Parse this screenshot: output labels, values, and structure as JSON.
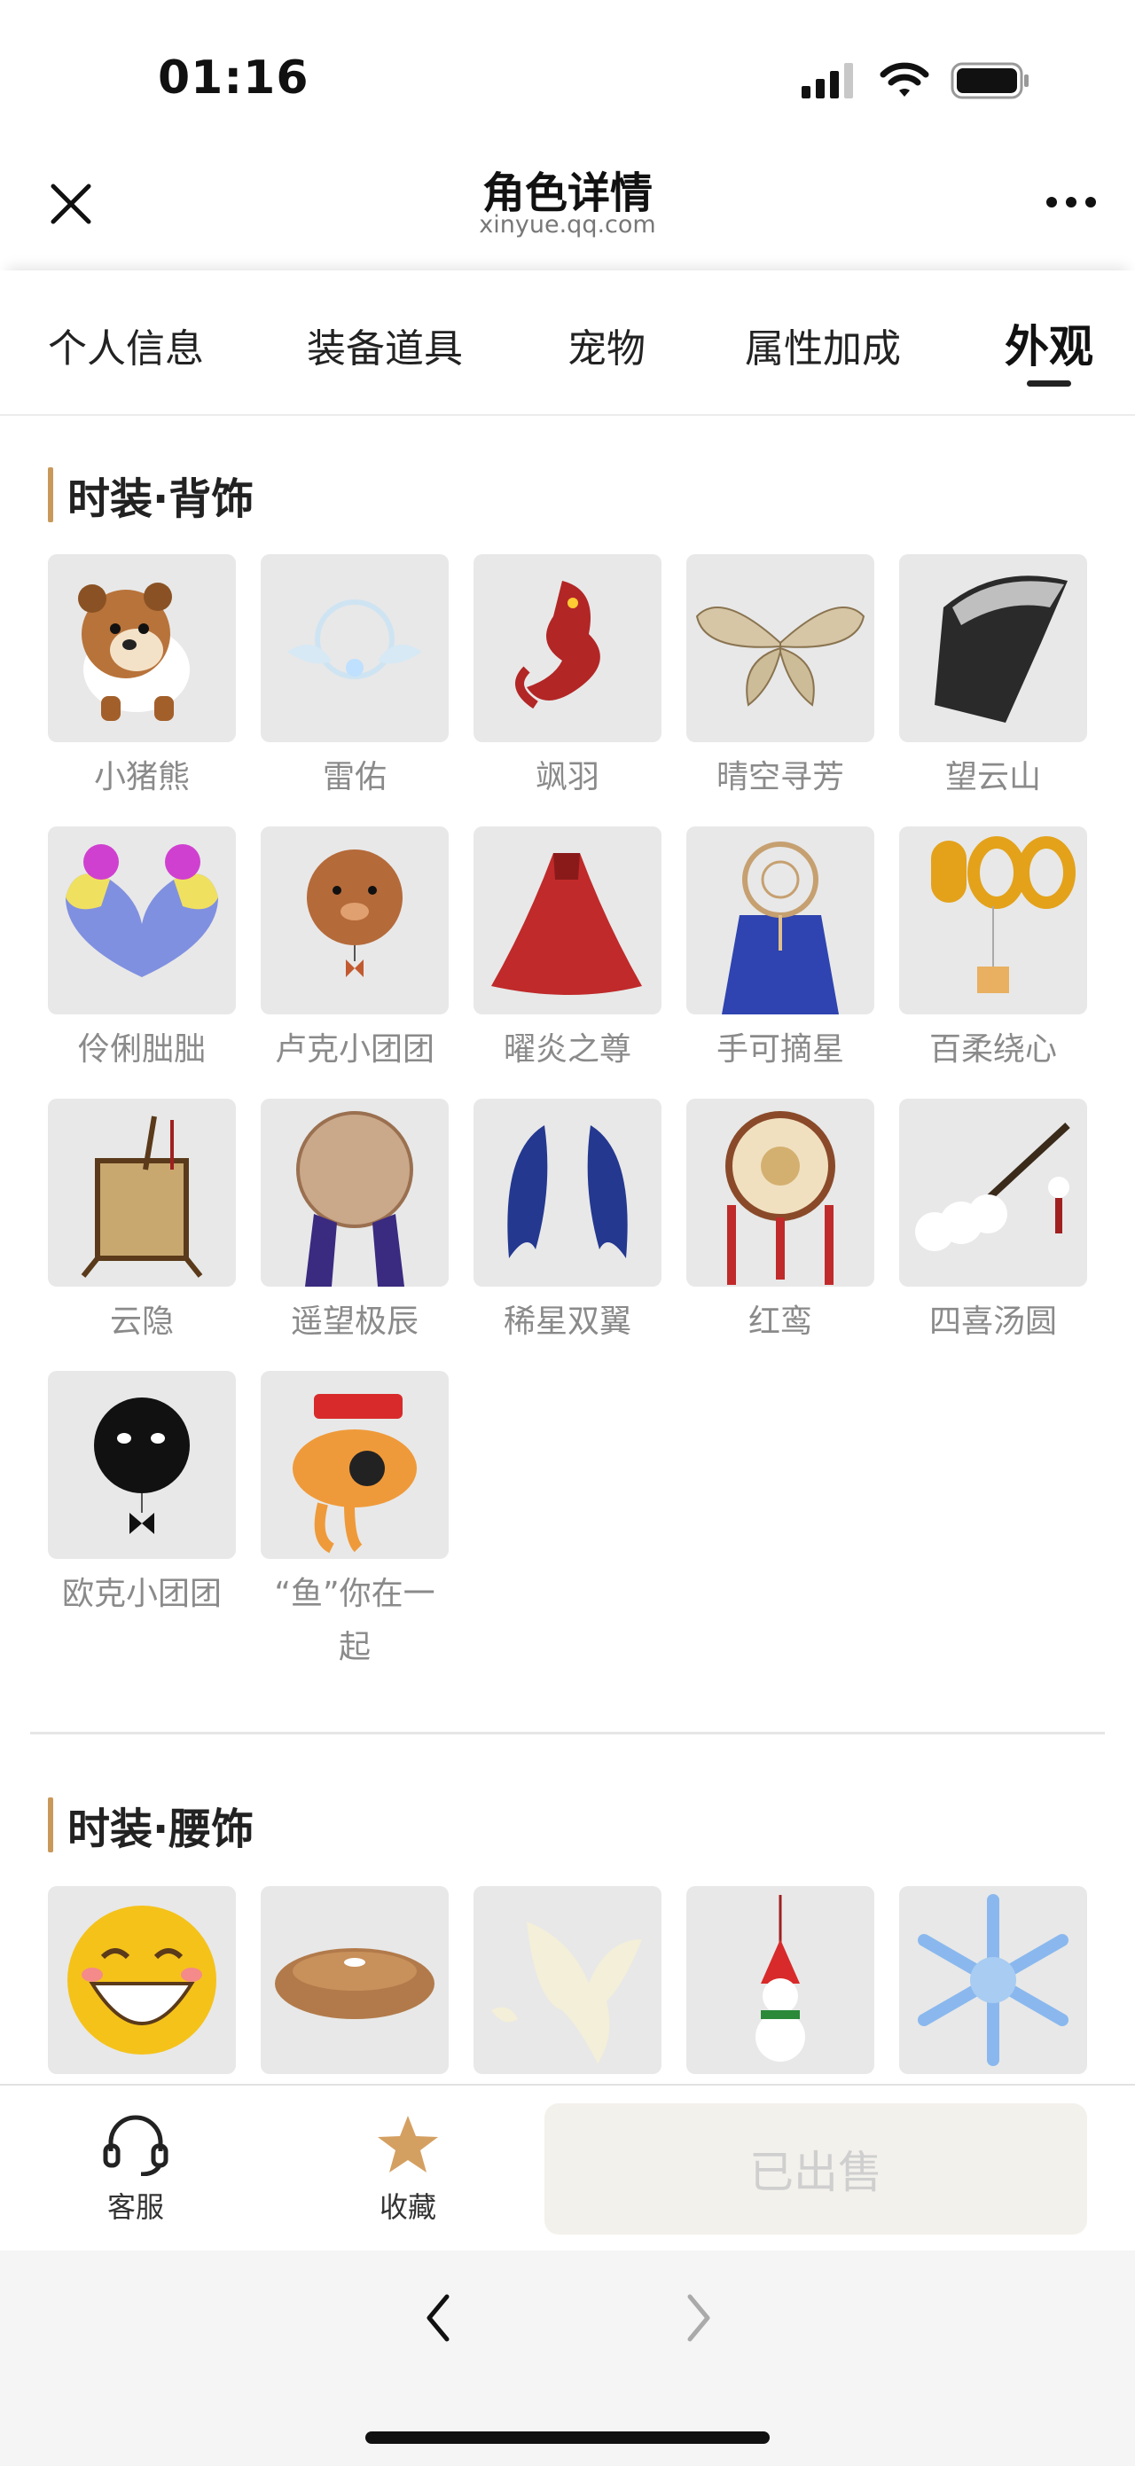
{
  "status_bar": {
    "time": "01:16"
  },
  "nav": {
    "title": "角色详情",
    "subtitle": "xinyue.qq.com"
  },
  "tabs": [
    {
      "label": "个人信息"
    },
    {
      "label": "装备道具"
    },
    {
      "label": "宠物"
    },
    {
      "label": "属性加成"
    },
    {
      "label": "外观",
      "active": true
    }
  ],
  "sections": {
    "back": {
      "title": "时装·背饰",
      "items": [
        {
          "label": "小猪熊"
        },
        {
          "label": "雷佑"
        },
        {
          "label": "飒羽"
        },
        {
          "label": "晴空寻芳"
        },
        {
          "label": "望云山"
        },
        {
          "label": "伶俐朏朏"
        },
        {
          "label": "卢克小团团"
        },
        {
          "label": "曜炎之尊"
        },
        {
          "label": "手可摘星"
        },
        {
          "label": "百柔绕心"
        },
        {
          "label": "云隐"
        },
        {
          "label": "遥望极辰"
        },
        {
          "label": "稀星双翼"
        },
        {
          "label": "红鸾"
        },
        {
          "label": "四喜汤圆"
        },
        {
          "label": "欧克小团团"
        },
        {
          "label": "“鱼”你在一起"
        }
      ]
    },
    "waist": {
      "title": "时装·腰饰",
      "items": [
        {
          "label": ""
        },
        {
          "label": ""
        },
        {
          "label": ""
        },
        {
          "label": ""
        },
        {
          "label": ""
        }
      ]
    }
  },
  "bottom_bar": {
    "service_label": "客服",
    "favorite_label": "收藏",
    "sold_label": "已出售"
  },
  "colors": {
    "accent": "#c9995b",
    "favorite_star": "#d4a062",
    "sold_bg": "#f3f1ec"
  }
}
